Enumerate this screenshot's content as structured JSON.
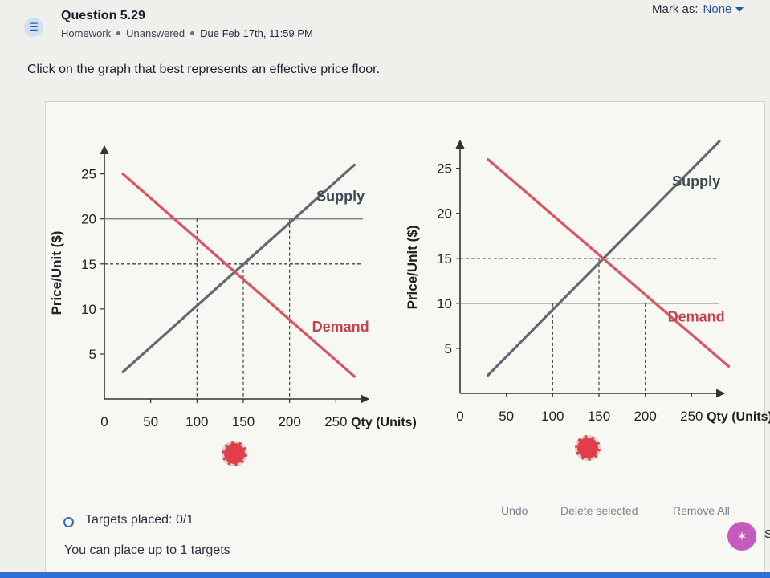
{
  "header": {
    "question_title": "Question 5.29",
    "category": "Homework",
    "status": "Unanswered",
    "due": "Due Feb 17th, 11:59 PM",
    "mark_as_label": "Mark as:",
    "mark_as_value": "None",
    "list_icon_glyph": "☰"
  },
  "prompt": "Click on the graph that best represents an effective price floor.",
  "chart_data": [
    {
      "type": "line",
      "xlabel": "Qty (Units)",
      "ylabel": "Price/Unit ($)",
      "x_ticks": [
        0,
        50,
        100,
        150,
        200,
        250
      ],
      "y_ticks": [
        5,
        10,
        15,
        20,
        25
      ],
      "xlim": [
        0,
        300
      ],
      "ylim": [
        0,
        28
      ],
      "series": [
        {
          "name": "Supply",
          "color": "#5f6b70",
          "points": [
            [
              20,
              3
            ],
            [
              270,
              26
            ]
          ]
        },
        {
          "name": "Demand",
          "color": "#d9555f",
          "points": [
            [
              20,
              25
            ],
            [
              270,
              2.5
            ]
          ]
        }
      ],
      "horizontal_lines": [
        {
          "y": 20,
          "style": "solid",
          "color": "#7a8086"
        },
        {
          "y": 15,
          "style": "dashed",
          "color": "#444"
        }
      ],
      "vertical_dashed": [
        {
          "x": 100,
          "y": 20
        },
        {
          "x": 150,
          "y": 15
        },
        {
          "x": 200,
          "y": 20
        }
      ],
      "annotations": [
        {
          "text": "Supply",
          "x": 255,
          "y": 22,
          "color": "#3d4a52"
        },
        {
          "text": "Demand",
          "x": 255,
          "y": 7.5,
          "color": "#c44250"
        }
      ]
    },
    {
      "type": "line",
      "xlabel": "Qty (Units)",
      "ylabel": "Price/Unit ($)",
      "x_ticks": [
        0,
        50,
        100,
        150,
        200,
        250
      ],
      "y_ticks": [
        5,
        10,
        15,
        20,
        25
      ],
      "xlim": [
        0,
        300
      ],
      "ylim": [
        0,
        28
      ],
      "series": [
        {
          "name": "Supply",
          "color": "#5f6b70",
          "points": [
            [
              30,
              2
            ],
            [
              280,
              28
            ]
          ]
        },
        {
          "name": "Demand",
          "color": "#d9555f",
          "points": [
            [
              30,
              26
            ],
            [
              290,
              3
            ]
          ]
        }
      ],
      "horizontal_lines": [
        {
          "y": 10,
          "style": "solid",
          "color": "#7a8086"
        },
        {
          "y": 15,
          "style": "dashed",
          "color": "#444"
        }
      ],
      "vertical_dashed": [
        {
          "x": 100,
          "y": 10
        },
        {
          "x": 150,
          "y": 15
        },
        {
          "x": 200,
          "y": 10
        }
      ],
      "annotations": [
        {
          "text": "Supply",
          "x": 255,
          "y": 23,
          "color": "#3d4a52"
        },
        {
          "text": "Demand",
          "x": 255,
          "y": 8,
          "color": "#c44250"
        }
      ]
    }
  ],
  "footer": {
    "targets_placed": "Targets placed: 0/1",
    "limit": "You can place up to 1 targets",
    "undo": "Undo",
    "delete_selected": "Delete selected",
    "remove_all": "Remove All",
    "fab_label": "S"
  },
  "colors": {
    "accent": "#2457a8",
    "marker": "#e13e49",
    "fab": "#c65bbd"
  }
}
